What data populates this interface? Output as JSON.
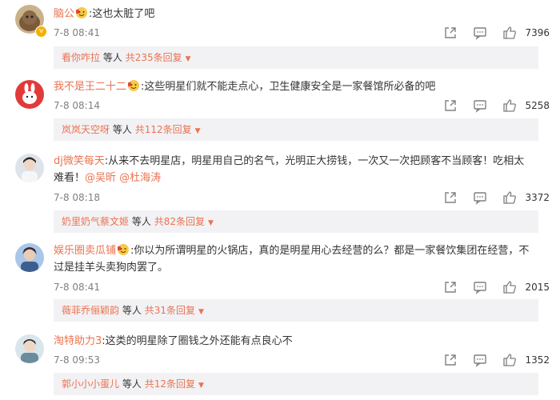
{
  "comments": [
    {
      "username": "脑公",
      "has_emoji": true,
      "text": ":这也太脏了吧",
      "time": "7-8 08:41",
      "likes": "7396",
      "reply": {
        "first_replier": "看你咋拉",
        "middle": "等人",
        "total": "共235条回复"
      }
    },
    {
      "username": "我不是王二十二",
      "has_emoji": true,
      "text": ":这些明星们就不能走点心，卫生健康安全是一家餐馆所必备的吧",
      "time": "7-8 08:14",
      "likes": "5258",
      "reply": {
        "first_replier": "岚岚天空呀",
        "middle": "等人",
        "total": "共112条回复"
      }
    },
    {
      "username": "dj微笑每天",
      "has_emoji": false,
      "text": ":从来不去明星店，明星用自己的名气，光明正大捞钱，一次又一次把顾客不当顾客！吃相太难看！",
      "mentions": [
        "@吴昕",
        "@杜海涛"
      ],
      "time": "7-8 08:18",
      "likes": "3372",
      "reply": {
        "first_replier": "奶里奶气蔡文姬",
        "middle": "等人",
        "total": "共82条回复"
      }
    },
    {
      "username": "娱乐圈卖瓜铺",
      "has_emoji": true,
      "text": ":你以为所谓明星的火锅店，真的是明星用心去经营的么？都是一家餐饮集团在经营，不过是挂羊头卖狗肉罢了。",
      "time": "7-8 08:41",
      "likes": "2015",
      "reply": {
        "first_replier": "薇菲乔俪颖韵",
        "middle": "等人",
        "total": "共31条回复"
      }
    },
    {
      "username": "淘特助力3",
      "has_emoji": false,
      "text": ":这类的明星除了圈钱之外还能有点良心不",
      "time": "7-8 09:53",
      "likes": "1352",
      "reply": {
        "first_replier": "郭小小小蛋儿",
        "middle": "等人",
        "total": "共12条回复"
      }
    }
  ],
  "icons": {
    "share": "share-icon",
    "comment": "comment-icon",
    "like": "thumbs-up-icon",
    "expand": "caret-down-icon"
  },
  "colors": {
    "username": "#eb7350",
    "reply_bar_bg": "#f2f2f5",
    "meta_text": "#808080"
  }
}
